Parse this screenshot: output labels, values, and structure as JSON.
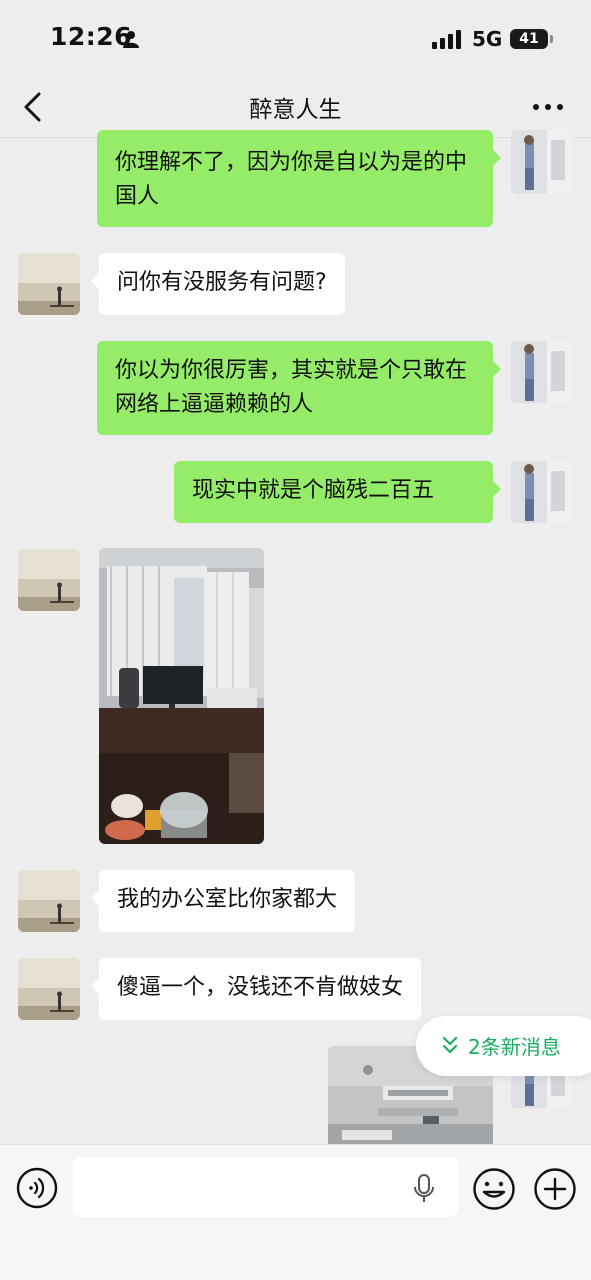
{
  "status_bar": {
    "time": "12:26",
    "network": "5G",
    "battery": "41",
    "icons": [
      "person-icon",
      "signal-icon",
      "battery-icon"
    ]
  },
  "nav": {
    "title": "醉意人生",
    "icons": [
      "back-icon",
      "more-icon"
    ]
  },
  "messages": [
    {
      "from": "self",
      "type": "text",
      "text": "你理解不了，因为你是自以为是的中国人"
    },
    {
      "from": "other",
      "type": "text",
      "text": "问你有没服务有问题?"
    },
    {
      "from": "self",
      "type": "text",
      "text": "你以为你很厉害，其实就是个只敢在网络上逼逼赖赖的人"
    },
    {
      "from": "self",
      "type": "text",
      "text": "现实中就是个脑残二百五"
    },
    {
      "from": "other",
      "type": "image",
      "subject": "office-desk-photo"
    },
    {
      "from": "other",
      "type": "text",
      "text": "我的办公室比你家都大"
    },
    {
      "from": "other",
      "type": "text",
      "text": "傻逼一个，没钱还不肯做妓女"
    },
    {
      "from": "self",
      "type": "image",
      "subject": "office-ceiling-photo"
    }
  ],
  "new_messages": {
    "label": "2条新消息",
    "color": "#1aad5f"
  },
  "input_bar": {
    "value": "",
    "icons": [
      "voice-icon",
      "mic-icon",
      "emoji-icon",
      "plus-icon"
    ]
  },
  "colors": {
    "self_bubble": "#95ec69",
    "other_bubble": "#ffffff",
    "background": "#ededed"
  }
}
